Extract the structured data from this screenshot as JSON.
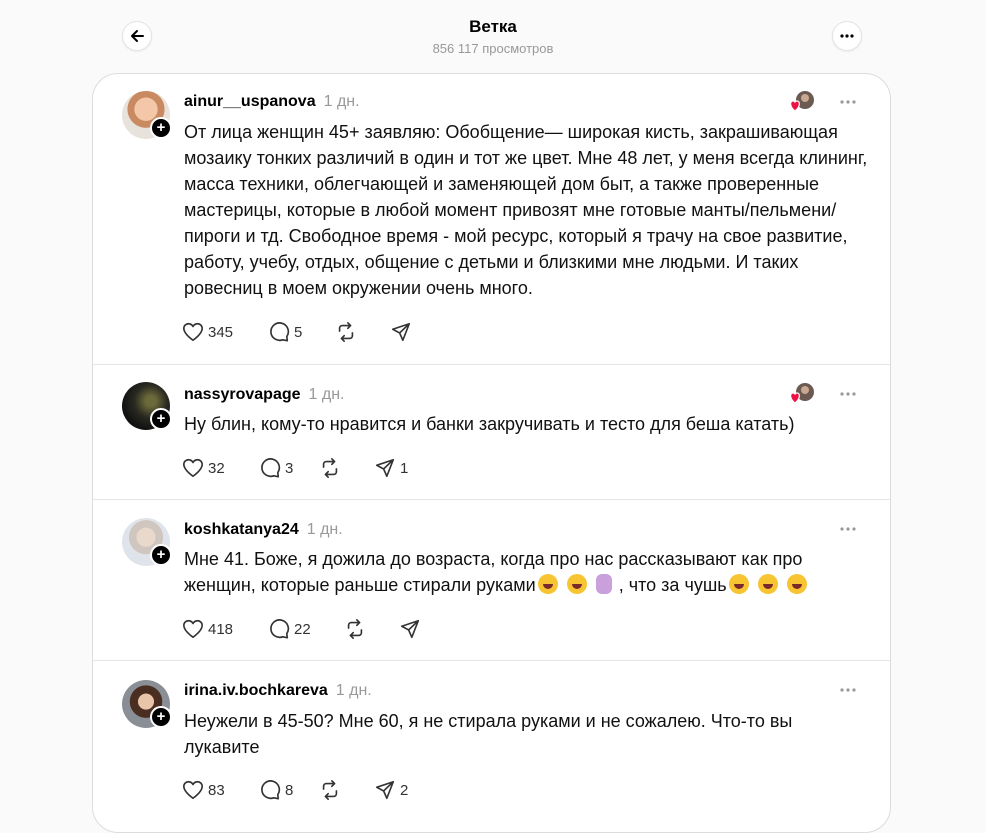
{
  "header": {
    "title": "Ветка",
    "views": "856 117 просмотров"
  },
  "colors": {
    "heart": "#ee1144",
    "muted": "#999999",
    "border": "#e5e5e5"
  },
  "posts": [
    {
      "username": "ainur__uspanova",
      "time": "1 дн.",
      "text": "От лица женщин 45+ заявляю: Обобщение— широкая кисть, закрашивающая мозаику тонких различий в один и тот же цвет. Мне 48 лет, у меня всегда клининг, масса техники, облегчающей и заменяющей дом быт, а также проверенные мастерицы, которые в любой момент привозят мне готовые манты/пельмени/пироги и тд. Свободное время - мой ресурс, который я трачу на свое развитие, работу, учебу, отдых, общение с детьми и близкими мне людьми. И таких ровесниц в моем окружении очень много.",
      "likes": "345",
      "replies": "5",
      "reposts": "",
      "shares": ""
    },
    {
      "username": "nassyrovapage",
      "time": "1 дн.",
      "text": "Ну блин, кому-то нравится и банки закручивать и тесто для беша катать)",
      "likes": "32",
      "replies": "3",
      "reposts": "",
      "shares": "1"
    },
    {
      "username": "koshkatanya24",
      "time": "1 дн.",
      "text_part1": "Мне 41. Боже, я дожила до возраста, когда про нас рассказывают как про женщин, которые раньше стирали руками",
      "text_part2": ", что за чушь",
      "likes": "418",
      "replies": "22",
      "reposts": "",
      "shares": ""
    },
    {
      "username": "irina.iv.bochkareva",
      "time": "1 дн.",
      "text": "Неужели в 45-50? Мне 60, я не стирала руками и не сожалею. Что-то вы лукавите",
      "likes": "83",
      "replies": "8",
      "reposts": "",
      "shares": "2"
    }
  ]
}
